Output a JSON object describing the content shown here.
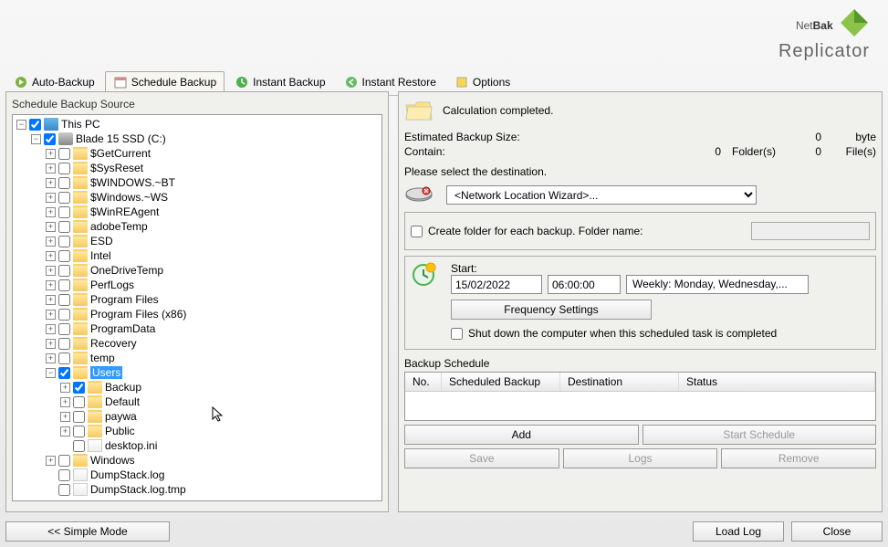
{
  "logo": {
    "brand1": "Net",
    "brand2": "Bak",
    "sub": "Replicator"
  },
  "toolbar": {
    "auto_backup": "Auto-Backup",
    "schedule_backup": "Schedule Backup",
    "instant_backup": "Instant Backup",
    "instant_restore": "Instant Restore",
    "options": "Options"
  },
  "left": {
    "title": "Schedule Backup Source",
    "tree": {
      "this_pc": "This PC",
      "drive": "Blade 15 SSD (C:)",
      "folders": [
        "$GetCurrent",
        "$SysReset",
        "$WINDOWS.~BT",
        "$Windows.~WS",
        "$WinREAgent",
        "adobeTemp",
        "ESD",
        "Intel",
        "OneDriveTemp",
        "PerfLogs",
        "Program Files",
        "Program Files (x86)",
        "ProgramData",
        "Recovery",
        "temp"
      ],
      "users": "Users",
      "users_children": [
        "Backup",
        "Default",
        "paywa",
        "Public"
      ],
      "desktop_ini": "desktop.ini",
      "tail": [
        "Windows",
        "DumpStack.log",
        "DumpStack.log.tmp"
      ]
    }
  },
  "right": {
    "status": "Calculation completed.",
    "est_label": "Estimated Backup Size:",
    "est_val": "0",
    "est_unit": "byte",
    "contain_label": "Contain:",
    "contain_folders_val": "0",
    "contain_folders_unit": "Folder(s)",
    "contain_files_val": "0",
    "contain_files_unit": "File(s)",
    "select_dest": "Please select the destination.",
    "dest_value": "<Network Location Wizard>...",
    "create_folder": "Create folder for each backup. Folder name:",
    "start_label": "Start:",
    "date": "15/02/2022",
    "time": "06:00:00",
    "freq_summary": "Weekly: Monday, Wednesday,...",
    "freq_btn": "Frequency Settings",
    "shutdown": "Shut down the computer when this scheduled task is completed",
    "schedule_title": "Backup Schedule",
    "th_no": "No.",
    "th_sb": "Scheduled Backup",
    "th_dest": "Destination",
    "th_status": "Status",
    "btn_add": "Add",
    "btn_start": "Start Schedule",
    "btn_save": "Save",
    "btn_logs": "Logs",
    "btn_remove": "Remove"
  },
  "bottom": {
    "simple": "<< Simple Mode",
    "load_log": "Load Log",
    "close": "Close"
  }
}
